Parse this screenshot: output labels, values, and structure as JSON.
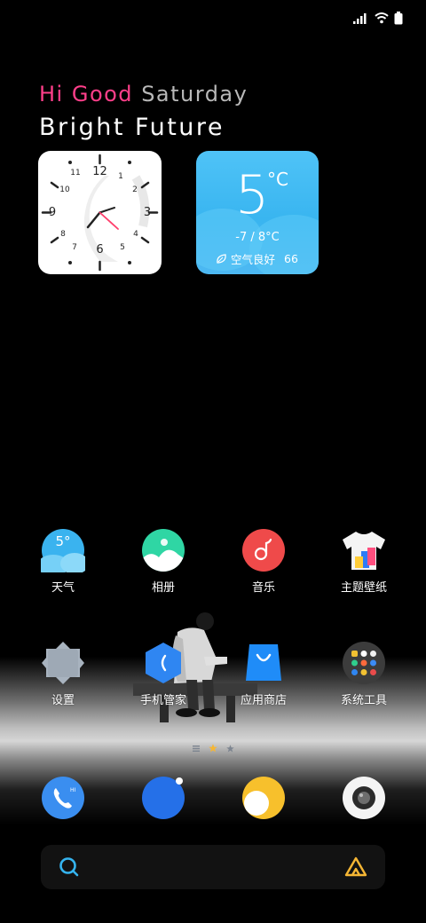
{
  "greeting": {
    "part1": "Hi Good",
    "part2": "Saturday"
  },
  "tagline": "Bright Future",
  "clock_widget": {
    "numerals": [
      "12",
      "1",
      "2",
      "3",
      "4",
      "5",
      "6",
      "7",
      "8",
      "9",
      "10",
      "11"
    ]
  },
  "weather_widget": {
    "temp": "5",
    "unit": "°C",
    "range": "-7 / 8°C",
    "aqi_label": "空气良好",
    "aqi_value": "66"
  },
  "apps_row1": [
    {
      "label": "天气",
      "icon": "weather-icon",
      "badge": "5°"
    },
    {
      "label": "相册",
      "icon": "gallery-icon"
    },
    {
      "label": "音乐",
      "icon": "music-icon"
    },
    {
      "label": "主题壁纸",
      "icon": "theme-tshirt-icon"
    }
  ],
  "apps_row2": [
    {
      "label": "设置",
      "icon": "settings-icon"
    },
    {
      "label": "手机管家",
      "icon": "phone-manager-icon"
    },
    {
      "label": "应用商店",
      "icon": "app-store-bag-icon"
    },
    {
      "label": "系统工具",
      "icon": "system-tools-folder-icon"
    }
  ],
  "page_indicator": {
    "pages": 3,
    "current": 2
  },
  "dock": [
    {
      "icon": "phone-icon",
      "badge": "HI"
    },
    {
      "icon": "browser-icon"
    },
    {
      "icon": "messages-icon"
    },
    {
      "icon": "camera-icon"
    }
  ],
  "colors": {
    "pink": "#ff3f8a",
    "weather_blue": "#42bdf5",
    "music_red": "#ef4a4a",
    "dock_blue": "#3a8ef0"
  }
}
